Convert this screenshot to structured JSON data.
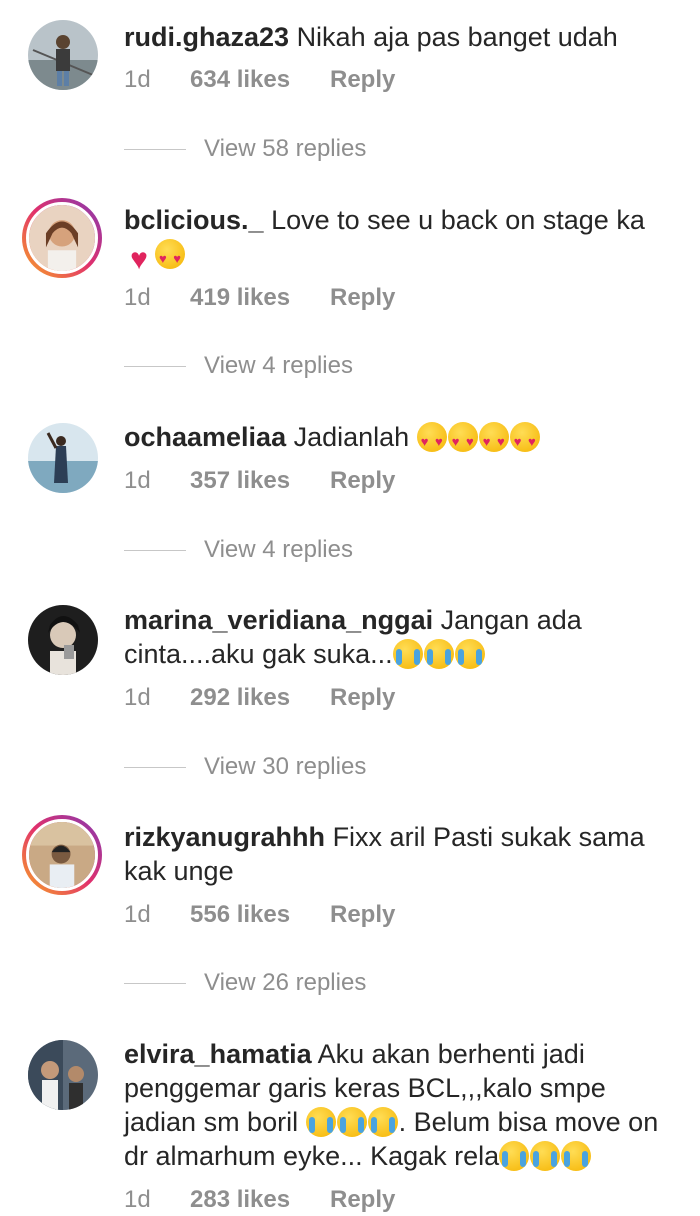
{
  "colors": {
    "text": "#262626",
    "muted": "#8e8e8e",
    "heart": "#e0245e"
  },
  "comments": [
    {
      "username": "rudi.ghaza23",
      "text": "Nikah aja pas banget udah",
      "time": "1d",
      "likes": "634 likes",
      "reply": "Reply",
      "view_replies": "View 58 replies",
      "story_ring": false
    },
    {
      "username": "bclicious._",
      "text": "Love to see u back on stage ka",
      "time": "1d",
      "likes": "419 likes",
      "reply": "Reply",
      "view_replies": "View 4 replies",
      "story_ring": true,
      "emojis": [
        "red-heart",
        "heart-eyes"
      ]
    },
    {
      "username": "ochaameliaa",
      "text": "Jadianlah",
      "time": "1d",
      "likes": "357 likes",
      "reply": "Reply",
      "view_replies": "View 4 replies",
      "story_ring": false,
      "emojis": [
        "heart-eyes",
        "heart-eyes",
        "heart-eyes",
        "heart-eyes"
      ]
    },
    {
      "username": "marina_veridiana_nggai",
      "text": "Jangan ada cinta....aku gak suka...",
      "time": "1d",
      "likes": "292 likes",
      "reply": "Reply",
      "view_replies": "View 30 replies",
      "story_ring": false,
      "emojis": [
        "cry",
        "cry",
        "cry"
      ]
    },
    {
      "username": "rizkyanugrahhh",
      "text": "Fixx aril Pasti sukak sama kak unge",
      "time": "1d",
      "likes": "556 likes",
      "reply": "Reply",
      "view_replies": "View 26 replies",
      "story_ring": true
    },
    {
      "username": "elvira_hamatia",
      "text_part1": "Aku akan berhenti jadi penggemar garis keras BCL,,,kalo smpe jadian sm boril",
      "text_part2": ". Belum bisa move on dr almarhum eyke... Kagak rela",
      "time": "1d",
      "likes": "283 likes",
      "reply": "Reply",
      "story_ring": false,
      "emojis_part1": [
        "cry",
        "cry",
        "cry"
      ],
      "emojis_part2": [
        "cry",
        "cry",
        "cry"
      ]
    }
  ]
}
